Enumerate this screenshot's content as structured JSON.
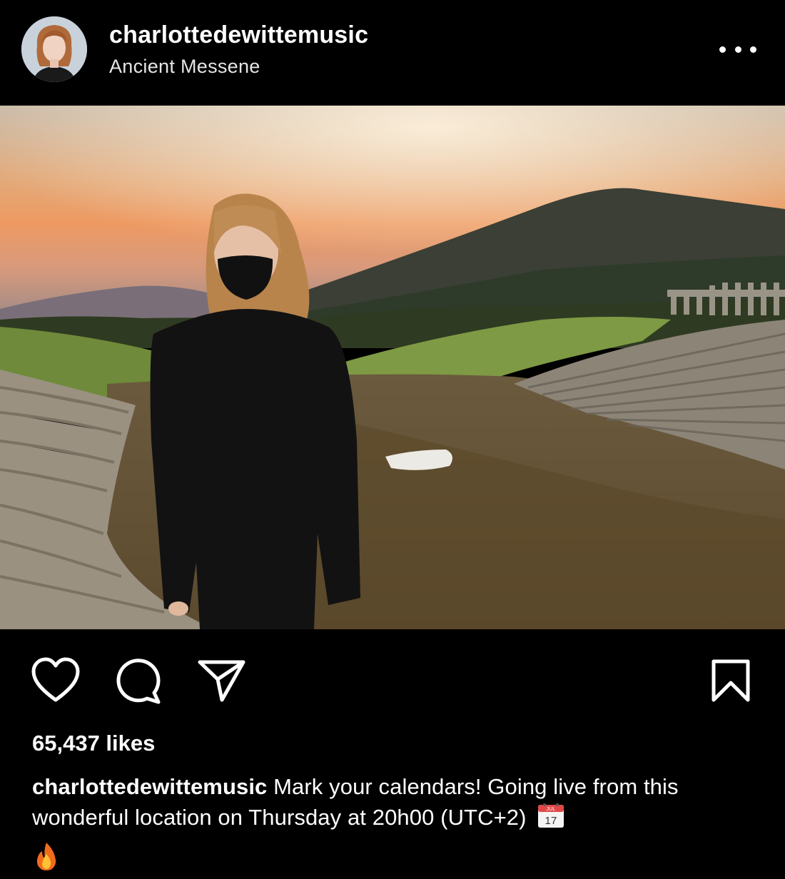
{
  "post": {
    "username": "charlottedewittemusic",
    "location": "Ancient Messene"
  },
  "icons": {
    "more": "more-options-icon",
    "like": "heart-icon",
    "comment": "comment-icon",
    "share": "share-icon",
    "save": "bookmark-icon",
    "calendar": "calendar-emoji",
    "fire": "fire-emoji"
  },
  "likes": "65,437 likes",
  "caption": {
    "username": "charlottedewittemusic",
    "text": "Mark your calendars! Going live from this wonderful location on Thursday at 20h00 (UTC+2)",
    "calendar_month": "JUL",
    "calendar_day": "17"
  },
  "colors": {
    "background": "#000000",
    "text": "#ffffff",
    "secondary_text": "#e6e6e6"
  }
}
